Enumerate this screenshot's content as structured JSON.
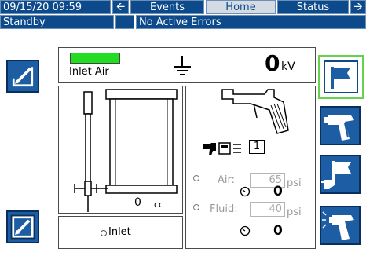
{
  "header": {
    "datetime": "09/15/20 09:59",
    "tabs": [
      {
        "label": "Events",
        "active": false
      },
      {
        "label": "Home",
        "active": true
      },
      {
        "label": "Status",
        "active": false
      }
    ],
    "prev_icon": "left-arrow-icon",
    "next_icon": "right-arrow-icon"
  },
  "status_bar": {
    "mode": "Standby",
    "errors": "No Active Errors"
  },
  "top_panel": {
    "indicator_label": "Inlet Air",
    "indicator_color": "#22dd22",
    "ground_icon": "ground-icon",
    "voltage_value": "0",
    "voltage_unit": "kV"
  },
  "pump_panel": {
    "volume_value": "0",
    "volume_unit": "cc"
  },
  "inlet_panel": {
    "label": "Inlet"
  },
  "gun_panel": {
    "gun_icon": "spray-gun-icon",
    "gun_number": "1",
    "air": {
      "label": "Air:",
      "setpoint": "65",
      "actual": "0",
      "unit": "psi"
    },
    "fluid": {
      "label": "Fluid:",
      "setpoint": "40",
      "actual": "0",
      "unit": "psi"
    }
  },
  "left_buttons": [
    {
      "icon": "edit-setup-icon"
    },
    {
      "icon": "edit-screen-icon"
    }
  ],
  "right_buttons": [
    {
      "icon": "flag-gun-icon",
      "selected": true
    },
    {
      "icon": "gun-trigger-icon"
    },
    {
      "icon": "gun-flush-icon"
    },
    {
      "icon": "gun-spray-icon"
    }
  ],
  "colors": {
    "header_blue": "#0c4a8c",
    "selected_outline": "#66d14c"
  }
}
